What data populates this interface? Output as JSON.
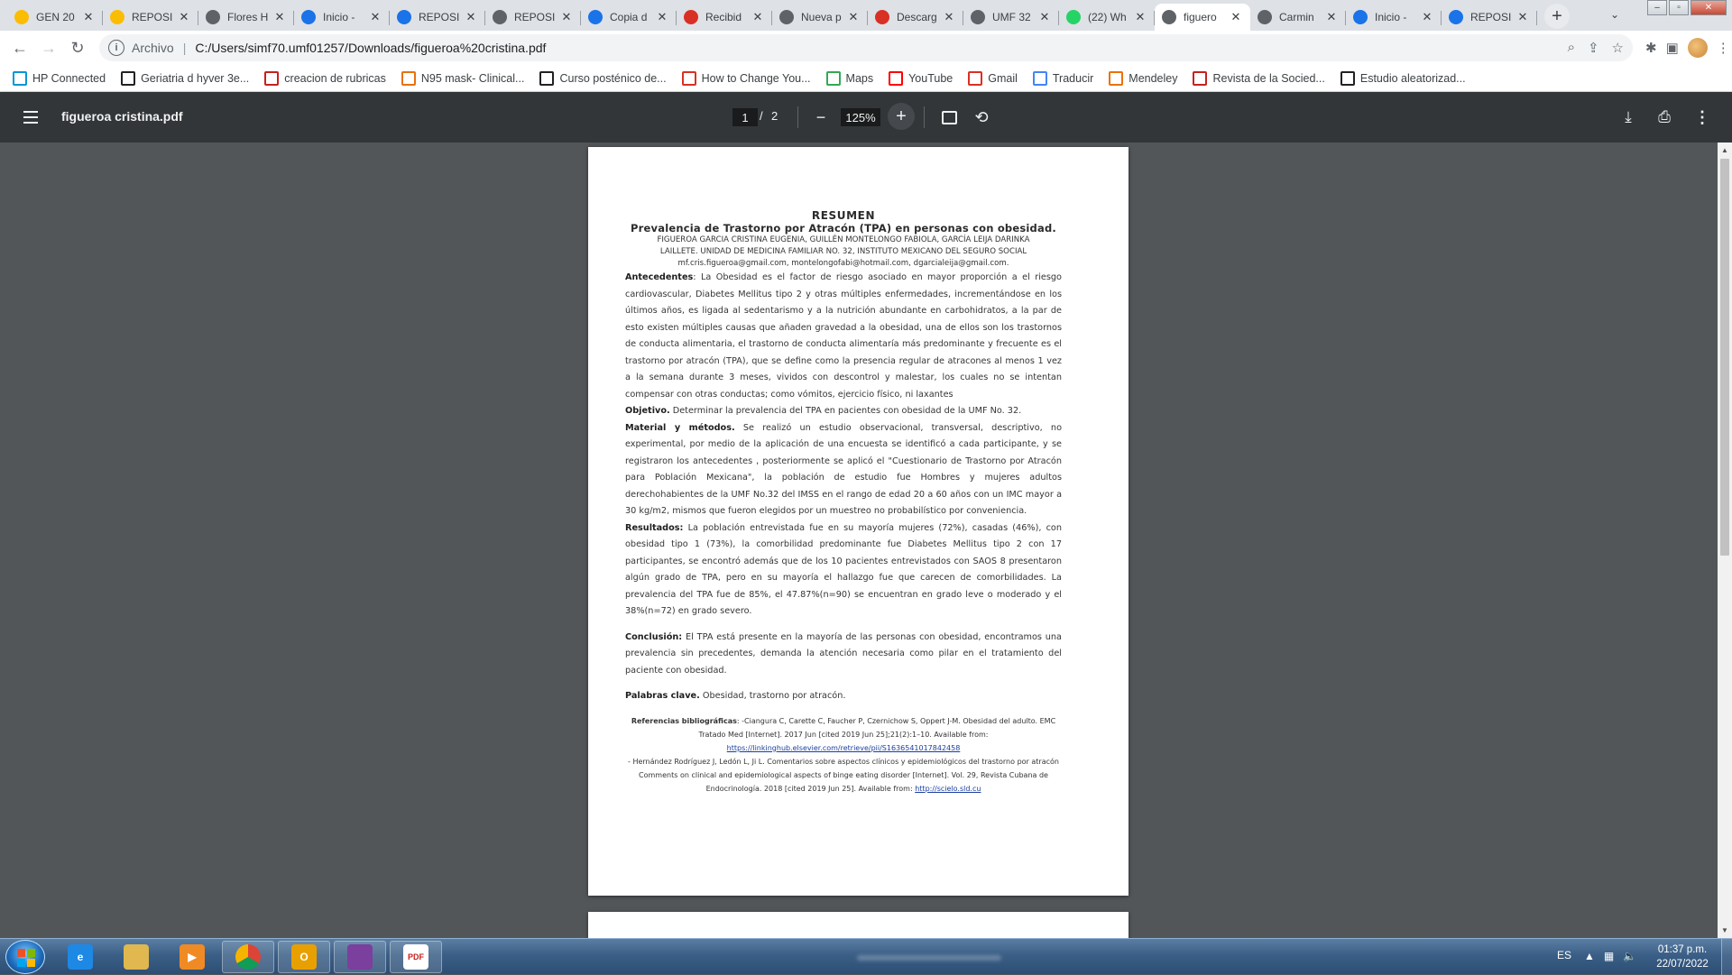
{
  "tabs": [
    {
      "label": "GEN 20",
      "icon": "google-drive-icon",
      "color": "#fbbc04",
      "active": false
    },
    {
      "label": "REPOSI",
      "icon": "google-drive-icon",
      "color": "#fbbc04",
      "active": false
    },
    {
      "label": "Flores H",
      "icon": "globe-icon",
      "color": "#5f6368",
      "active": false
    },
    {
      "label": "Inicio -",
      "icon": "edge-icon",
      "color": "#1a73e8",
      "active": false
    },
    {
      "label": "REPOSI",
      "icon": "edge-icon",
      "color": "#1a73e8",
      "active": false
    },
    {
      "label": "REPOSI",
      "icon": "globe-icon",
      "color": "#5f6368",
      "active": false
    },
    {
      "label": "Copia d",
      "icon": "edge-icon",
      "color": "#1a73e8",
      "active": false
    },
    {
      "label": "Recibid",
      "icon": "gmail-icon",
      "color": "#d93025",
      "active": false
    },
    {
      "label": "Nueva p",
      "icon": "globe-icon",
      "color": "#5f6368",
      "active": false
    },
    {
      "label": "Descarg",
      "icon": "pdf-heart-icon",
      "color": "#d93025",
      "active": false
    },
    {
      "label": "UMF 32",
      "icon": "globe-icon",
      "color": "#5f6368",
      "active": false
    },
    {
      "label": "(22) Wh",
      "icon": "whatsapp-icon",
      "color": "#25d366",
      "active": false
    },
    {
      "label": "figuero",
      "icon": "globe-icon",
      "color": "#5f6368",
      "active": true
    },
    {
      "label": "Carmin",
      "icon": "globe-icon",
      "color": "#5f6368",
      "active": false
    },
    {
      "label": "Inicio -",
      "icon": "edge-icon",
      "color": "#1a73e8",
      "active": false
    },
    {
      "label": "REPOSI",
      "icon": "edge-icon",
      "color": "#1a73e8",
      "active": false
    }
  ],
  "omnibox": {
    "scheme_label": "Archivo",
    "url": "C:/Users/simf70.umf01257/Downloads/figueroa%20cristina.pdf"
  },
  "bookmarks": [
    {
      "label": "HP Connected",
      "icon": "hp-icon",
      "color": "#0096d6"
    },
    {
      "label": "Geriatria d hyver 3e...",
      "icon": "letter-a-icon",
      "color": "#202124"
    },
    {
      "label": "creacion de rubricas",
      "icon": "rubric-icon",
      "color": "#c5221f"
    },
    {
      "label": "N95 mask- Clinical...",
      "icon": "ck-icon",
      "color": "#e8710a"
    },
    {
      "label": "Curso posténico de...",
      "icon": "s-circle-icon",
      "color": "#202124"
    },
    {
      "label": "How to Change You...",
      "icon": "gmail-icon",
      "color": "#d93025"
    },
    {
      "label": "Maps",
      "icon": "maps-icon",
      "color": "#34a853"
    },
    {
      "label": "YouTube",
      "icon": "youtube-icon",
      "color": "#ff0000"
    },
    {
      "label": "Gmail",
      "icon": "gmail-icon",
      "color": "#d93025"
    },
    {
      "label": "Traducir",
      "icon": "translate-icon",
      "color": "#4285f4"
    },
    {
      "label": "Mendeley",
      "icon": "mendeley-icon",
      "color": "#e8710a"
    },
    {
      "label": "Revista de la Socied...",
      "icon": "figure-icon",
      "color": "#c5221f"
    },
    {
      "label": "Estudio aleatorizad...",
      "icon": "w-icon",
      "color": "#202124"
    }
  ],
  "pdf": {
    "title": "figueroa cristina.pdf",
    "current_page": "1",
    "page_separator": "/",
    "total_pages": "2",
    "zoom": "125%"
  },
  "document": {
    "heading": "RESUMEN",
    "title": "Prevalencia de Trastorno por Atracón (TPA) en personas con obesidad.",
    "authors_1": "FIGUEROA GARCIA CRISTINA EUGENIA, GUILLÉN MONTELONGO FABIOLA, GARCÍA LEIJA DARINKA",
    "authors_2": "LAILLETE. UNIDAD DE MEDICINA FAMILIAR NO. 32, INSTITUTO MEXICANO DEL SEGURO SOCIAL",
    "emails": "mf.cris.figueroa@gmail.com, montelongofabi@hotmail.com, dgarcialeija@gmail.com.",
    "antecedentes_label": "Antecedentes",
    "antecedentes": ": La Obesidad es el factor de riesgo asociado en mayor proporción a el riesgo cardiovascular, Diabetes Mellitus tipo 2 y otras múltiples enfermedades, incrementándose en los últimos años, es ligada al sedentarismo y a la nutrición abundante en carbohidratos, a la par de esto existen múltiples causas que añaden gravedad a la obesidad, una de ellos son los trastornos de conducta alimentaria, el trastorno de conducta alimentaría más predominante y frecuente es el trastorno por atracón (TPA), que se define como la presencia regular de atracones al menos 1 vez a la semana durante 3 meses, vividos con descontrol y malestar, los cuales no se intentan compensar con otras conductas; como vómitos, ejercicio físico, ni laxantes",
    "objetivo_label": "Objetivo.",
    "objetivo": " Determinar la prevalencia del TPA en pacientes con obesidad de la UMF No. 32.",
    "material_label": "Material y métodos.",
    "material": " Se realizó un estudio observacional, transversal, descriptivo, no experimental, por medio de la aplicación de una encuesta se identificó a cada participante, y se registraron los antecedentes , posteriormente se aplicó el \"Cuestionario de Trastorno por Atracón para Población Mexicana\", la población de estudio fue Hombres y mujeres adultos derechohabientes de la UMF No.32 del IMSS en el rango de edad 20 a 60 años con un IMC mayor a 30 kg/m2, mismos que fueron elegidos por un muestreo no probabilístico por conveniencia.",
    "resultados_label": "Resultados:",
    "resultados": " La población entrevistada fue en su mayoría mujeres (72%), casadas (46%), con obesidad tipo 1 (73%), la comorbilidad predominante fue Diabetes Mellitus tipo 2 con 17 participantes, se encontró además que de los 10 pacientes entrevistados con SAOS 8 presentaron algún grado de TPA, pero en su mayoría el hallazgo fue que carecen de comorbilidades. La prevalencia del TPA fue de 85%, el 47.87%(n=90) se encuentran en grado leve o moderado y el 38%(n=72) en grado severo.",
    "conclusion_label": "Conclusión:",
    "conclusion": " El TPA está presente en la mayoría de las personas con obesidad, encontramos una prevalencia sin precedentes, demanda la atención necesaria como pilar en el tratamiento del paciente con obesidad.",
    "keywords_label": "Palabras clave.",
    "keywords": " Obesidad, trastorno por atracón.",
    "refs_label": "Referencias bibliográficas",
    "ref1": ": -Ciangura C, Carette C, Faucher P, Czernichow S, Oppert J-M. Obesidad del adulto. EMC Tratado Med [Internet]. 2017 Jun [cited 2019 Jun 25];21(2):1–10. Available from:",
    "ref1_link": "https://linkinghub.elsevier.com/retrieve/pii/S1636541017842458",
    "ref2": "- Hernández Rodríguez J, Ledón L, Ji L. Comentarios sobre aspectos clínicos y epidemiológicos del trastorno por atracón Comments on clinical and epidemiological aspects of binge eating disorder [Internet]. Vol. 29, Revista Cubana de Endocrinología. 2018 [cited 2019 Jun 25]. Available from: ",
    "ref2_link": "http://scielo.sld.cu"
  },
  "taskbar": {
    "apps": [
      {
        "name": "internet-explorer-icon",
        "color": "#1e88e5",
        "glyph": "e"
      },
      {
        "name": "file-explorer-icon",
        "color": "#e0b84f",
        "glyph": ""
      },
      {
        "name": "media-player-icon",
        "color": "#f08a24",
        "glyph": "▶"
      },
      {
        "name": "chrome-icon",
        "color": "#db4437",
        "glyph": ""
      },
      {
        "name": "outlook-icon",
        "color": "#e8a000",
        "glyph": "O"
      },
      {
        "name": "winrar-icon",
        "color": "#7b3f9e",
        "glyph": ""
      },
      {
        "name": "ilovepdf-icon",
        "color": "#ffffff",
        "glyph": "PDF"
      }
    ],
    "language": "ES",
    "time": "01:37 p.m.",
    "date": "22/07/2022"
  }
}
